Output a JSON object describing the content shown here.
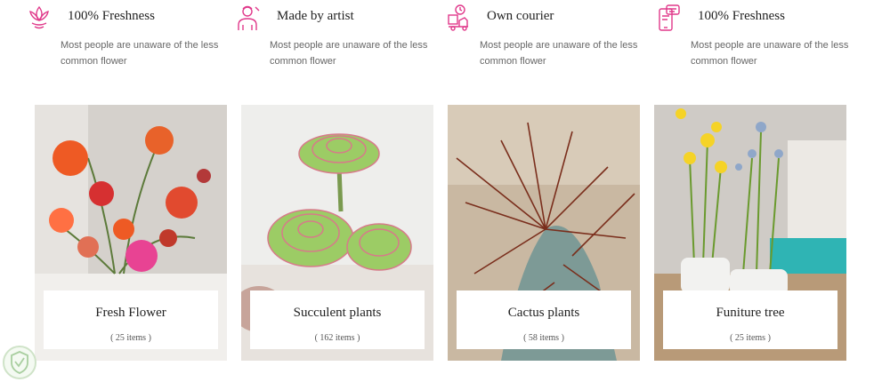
{
  "features": [
    {
      "icon": "lotus-icon",
      "title": "100% Freshness",
      "desc": "Most people are unaware of the less common flower"
    },
    {
      "icon": "artist-icon",
      "title": "Made by artist",
      "desc": "Most people are unaware of the less common flower"
    },
    {
      "icon": "courier-icon",
      "title": "Own courier",
      "desc": "Most people are unaware of the less common flower"
    },
    {
      "icon": "phone-chat-icon",
      "title": "100% Freshness",
      "desc": "Most people are unaware of the less common flower"
    }
  ],
  "categories": [
    {
      "title": "Fresh Flower",
      "count": "( 25 items )"
    },
    {
      "title": "Succulent plants",
      "count": "( 162 items )"
    },
    {
      "title": "Cactus plants",
      "count": "( 58 items )"
    },
    {
      "title": "Funiture tree",
      "count": "( 25 items )"
    }
  ],
  "colors": {
    "accent": "#e0388a"
  }
}
